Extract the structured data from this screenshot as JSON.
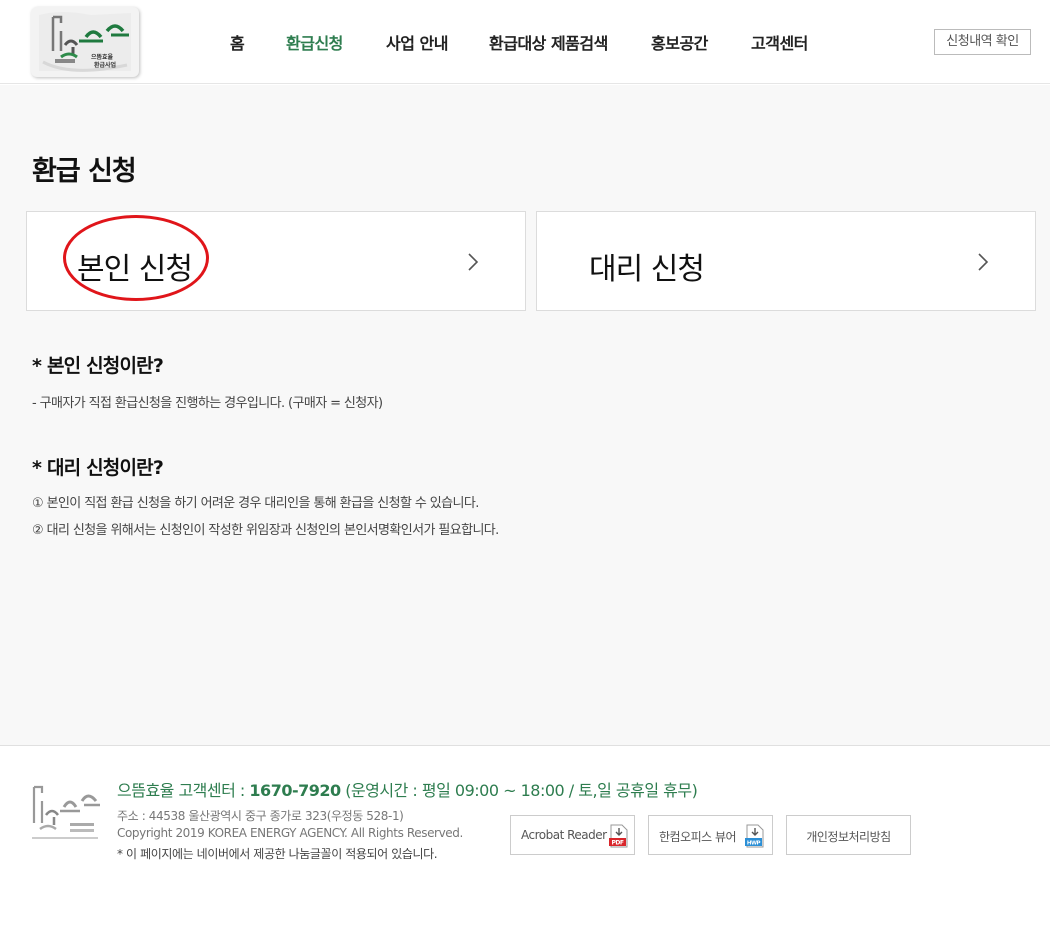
{
  "header": {
    "nav": [
      "홈",
      "환급신청",
      "사업 안내",
      "환급대상 제품검색",
      "홍보공간",
      "고객센터"
    ],
    "active_nav_index": 1,
    "status_button": "신청내역 확인"
  },
  "logo": {
    "text_line1": "으뜸효율",
    "text_line2": "환급사업",
    "sub": "Supreme Efficiency & Low Consumption"
  },
  "main": {
    "title": "환급 신청",
    "cards": [
      {
        "label": "본인 신청",
        "highlighted": true
      },
      {
        "label": "대리 신청",
        "highlighted": false
      }
    ],
    "sections": [
      {
        "title": "* 본인 신청이란?",
        "lines": [
          "- 구매자가 직접 환급신청을 진행하는 경우입니다. (구매자 = 신청자)"
        ]
      },
      {
        "title": "* 대리 신청이란?",
        "lines": [
          "① 본인이 직접 환급 신청을 하기 어려운 경우 대리인을 통해 환급을 신청할 수 있습니다.",
          "② 대리 신청을 위해서는 신청인이 작성한 위임장과 신청인의 본인서명확인서가 필요합니다."
        ]
      }
    ]
  },
  "footer": {
    "cs_label": "으뜸효율 고객센터 :",
    "phone": "1670-7920",
    "hours": "(운영시간 : 평일 09:00 ~ 18:00 / 토,일 공휴일 휴무)",
    "address": "주소 : 44538 울산광역시 중구 종가로 323(우정동 528-1)",
    "copyright": "Copyright 2019 KOREA ENERGY AGENCY. All Rights Reserved.",
    "font_note": "* 이 페이지에는 네이버에서 제공한 나눔글꼴이 적용되어 있습니다.",
    "buttons": [
      {
        "label": "Acrobat Reader",
        "icon": "pdf-download-icon",
        "badge": "PDF"
      },
      {
        "label": "한컴오피스 뷰어",
        "icon": "hwp-download-icon",
        "badge": "HWP"
      },
      {
        "label": "개인정보처리방침",
        "icon": "",
        "badge": ""
      }
    ]
  },
  "colors": {
    "accent_green": "#2e7d4f",
    "highlight_red": "#e0151a",
    "page_bg": "#f8f8f8"
  }
}
